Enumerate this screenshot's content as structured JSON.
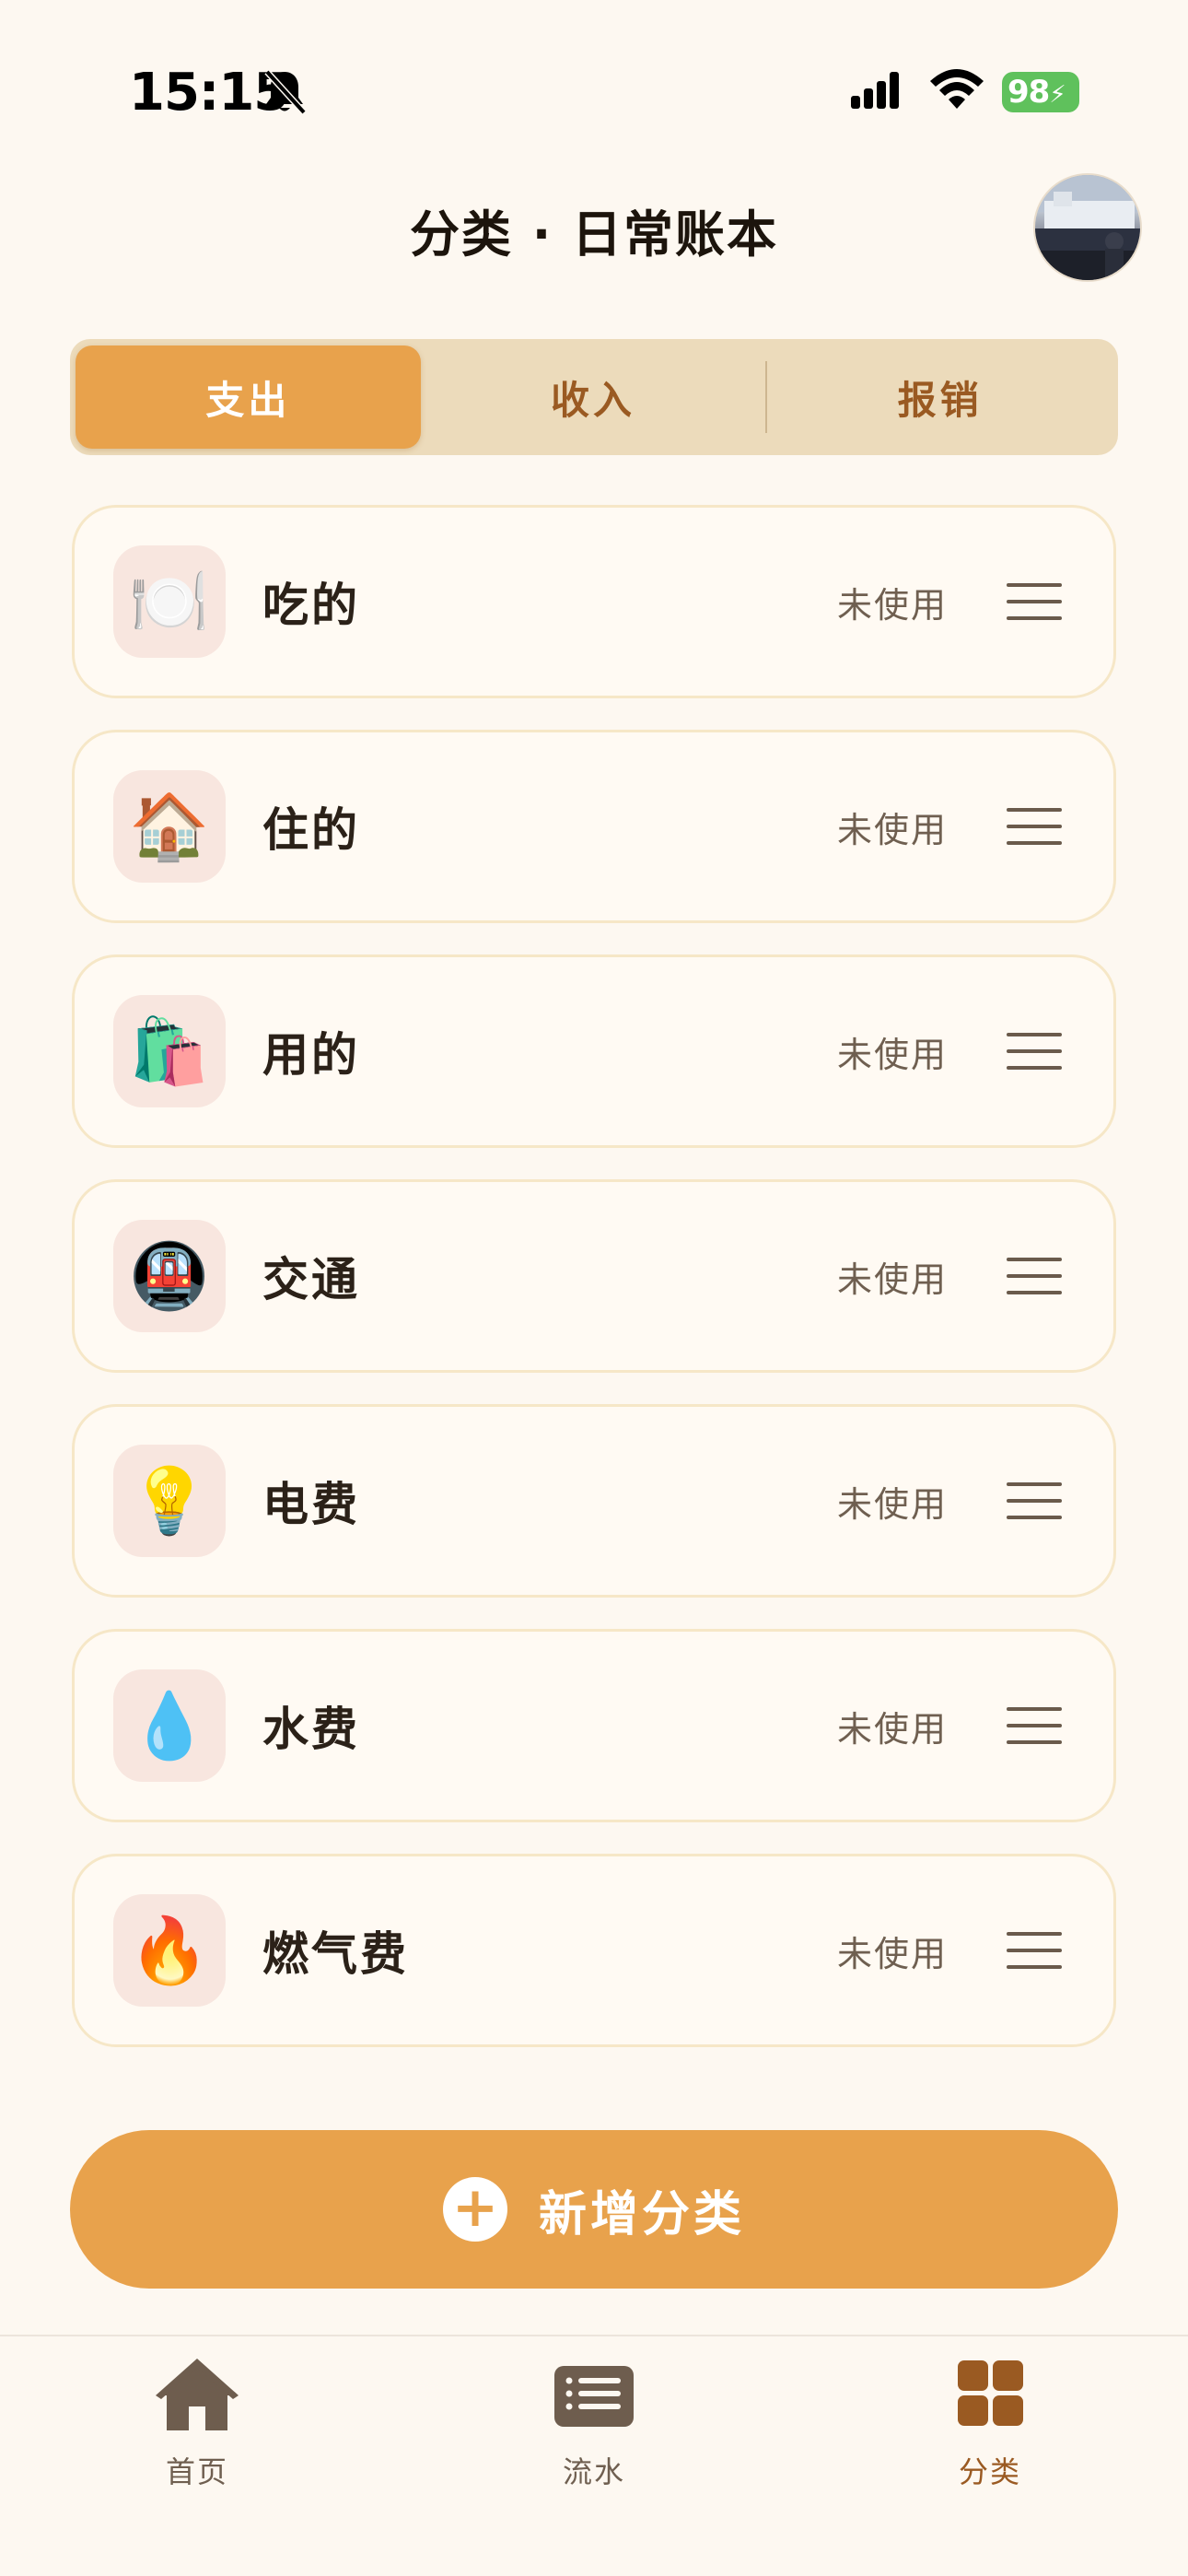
{
  "status_bar": {
    "time": "15:15",
    "battery": "98"
  },
  "header": {
    "title": "分类 · 日常账本"
  },
  "segments": [
    {
      "label": "支出",
      "active": true
    },
    {
      "label": "收入",
      "active": false
    },
    {
      "label": "报销",
      "active": false
    }
  ],
  "categories": [
    {
      "emoji": "🍽️",
      "icon": "plate-cutlery-icon",
      "name": "吃的",
      "status": "未使用"
    },
    {
      "emoji": "🏠",
      "icon": "house-icon",
      "name": "住的",
      "status": "未使用"
    },
    {
      "emoji": "🛍️",
      "icon": "shopping-bags-icon",
      "name": "用的",
      "status": "未使用"
    },
    {
      "emoji": "🚇",
      "icon": "metro-icon",
      "name": "交通",
      "status": "未使用"
    },
    {
      "emoji": "💡",
      "icon": "light-bulb-icon",
      "name": "电费",
      "status": "未使用"
    },
    {
      "emoji": "💧",
      "icon": "droplet-icon",
      "name": "水费",
      "status": "未使用"
    },
    {
      "emoji": "🔥",
      "icon": "fire-icon",
      "name": "燃气费",
      "status": "未使用"
    }
  ],
  "add_button": {
    "label": "新增分类"
  },
  "tabs": [
    {
      "label": "首页",
      "icon": "home-icon",
      "active": false
    },
    {
      "label": "流水",
      "icon": "list-icon",
      "active": false
    },
    {
      "label": "分类",
      "icon": "grid-icon",
      "active": true
    }
  ],
  "colors": {
    "accent": "#e8a24c",
    "background": "#fdf8f1",
    "segment_bg": "#ecdbbb",
    "active_tab_text": "#9a5a22",
    "card_border": "#f6e7c7",
    "icon_tile": "#f8e6df"
  }
}
